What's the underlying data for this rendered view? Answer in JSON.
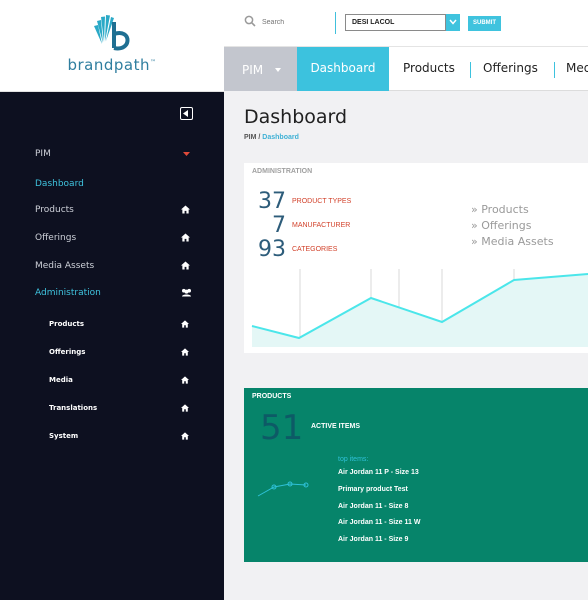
{
  "brand": {
    "name": "brandpath",
    "mark": "™"
  },
  "search": {
    "placeholder": "Search"
  },
  "select": {
    "value": "DESI LACOL"
  },
  "submit_label": "SUBMIT",
  "nav": {
    "pim": "PIM",
    "items": [
      "Dashboard",
      "Products",
      "Offerings",
      "Media"
    ]
  },
  "sidebar": {
    "items": [
      "PIM",
      "Dashboard",
      "Products",
      "Offerings",
      "Media Assets",
      "Administration"
    ],
    "sub_items": [
      "Products",
      "Offerings",
      "Media",
      "Translations",
      "System"
    ]
  },
  "page": {
    "title": "Dashboard",
    "breadcrumb_root": "PIM",
    "breadcrumb_sep": " / ",
    "breadcrumb_current": "Dashboard"
  },
  "admin": {
    "heading": "ADMINISTRATION",
    "stats": [
      {
        "value": "37",
        "label": "PRODUCT TYPES"
      },
      {
        "value": "7",
        "label": "MANUFACTURER"
      },
      {
        "value": "93",
        "label": "CATEGORIES"
      }
    ],
    "links": [
      "» Products",
      "» Offerings",
      "» Media Assets"
    ]
  },
  "products": {
    "heading": "PRODUCTS",
    "active_value": "51",
    "active_label": "ACTIVE ITEMS",
    "top_items_label": "top items:",
    "top_items": [
      "Air Jordan 11 P - Size 13",
      "Primary product Test",
      "Air Jordan 11 - Size 8",
      "Air Jordan 11 - Size 11 W",
      "Air Jordan 11 - Size 9"
    ]
  },
  "colors": {
    "accent": "#3cc2de",
    "sidebar_bg": "#0d1020",
    "products_card": "#06846a",
    "stat_label": "#d2422b"
  },
  "icons": [
    "search-icon",
    "chevron-down-icon",
    "collapse-icon",
    "home-icon",
    "users-icon",
    "brandpath-logo-icon"
  ]
}
